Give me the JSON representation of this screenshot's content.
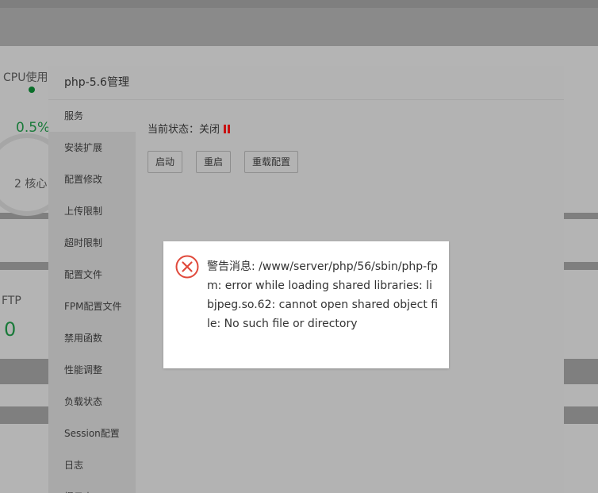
{
  "background": {
    "cpu_label": "CPU使用",
    "cpu_value": "0.5%",
    "cpu_cores": "2 核心",
    "ftp_label": "FTP",
    "ftp_value": "0"
  },
  "modal": {
    "title": "php-5.6管理",
    "sidebar_items": [
      {
        "label": "服务"
      },
      {
        "label": "安装扩展"
      },
      {
        "label": "配置修改"
      },
      {
        "label": "上传限制"
      },
      {
        "label": "超时限制"
      },
      {
        "label": "配置文件"
      },
      {
        "label": "FPM配置文件"
      },
      {
        "label": "禁用函数"
      },
      {
        "label": "性能调整"
      },
      {
        "label": "负载状态"
      },
      {
        "label": "Session配置"
      },
      {
        "label": "日志"
      },
      {
        "label": "慢日志"
      }
    ],
    "content": {
      "status_text": "当前状态：关闭",
      "buttons": {
        "start": "启动",
        "restart": "重启",
        "reload": "重载配置"
      }
    }
  },
  "alert": {
    "message": "警告消息: /www/server/php/56/sbin/php-fpm: error while loading shared libraries: libjpeg.so.62: cannot open shared object file: No such file or directory",
    "icon": "error-circle-x-icon",
    "icon_color": "#e0493b"
  },
  "colors": {
    "running_green": "#1a7a3a",
    "stopped_red": "#c81010"
  }
}
